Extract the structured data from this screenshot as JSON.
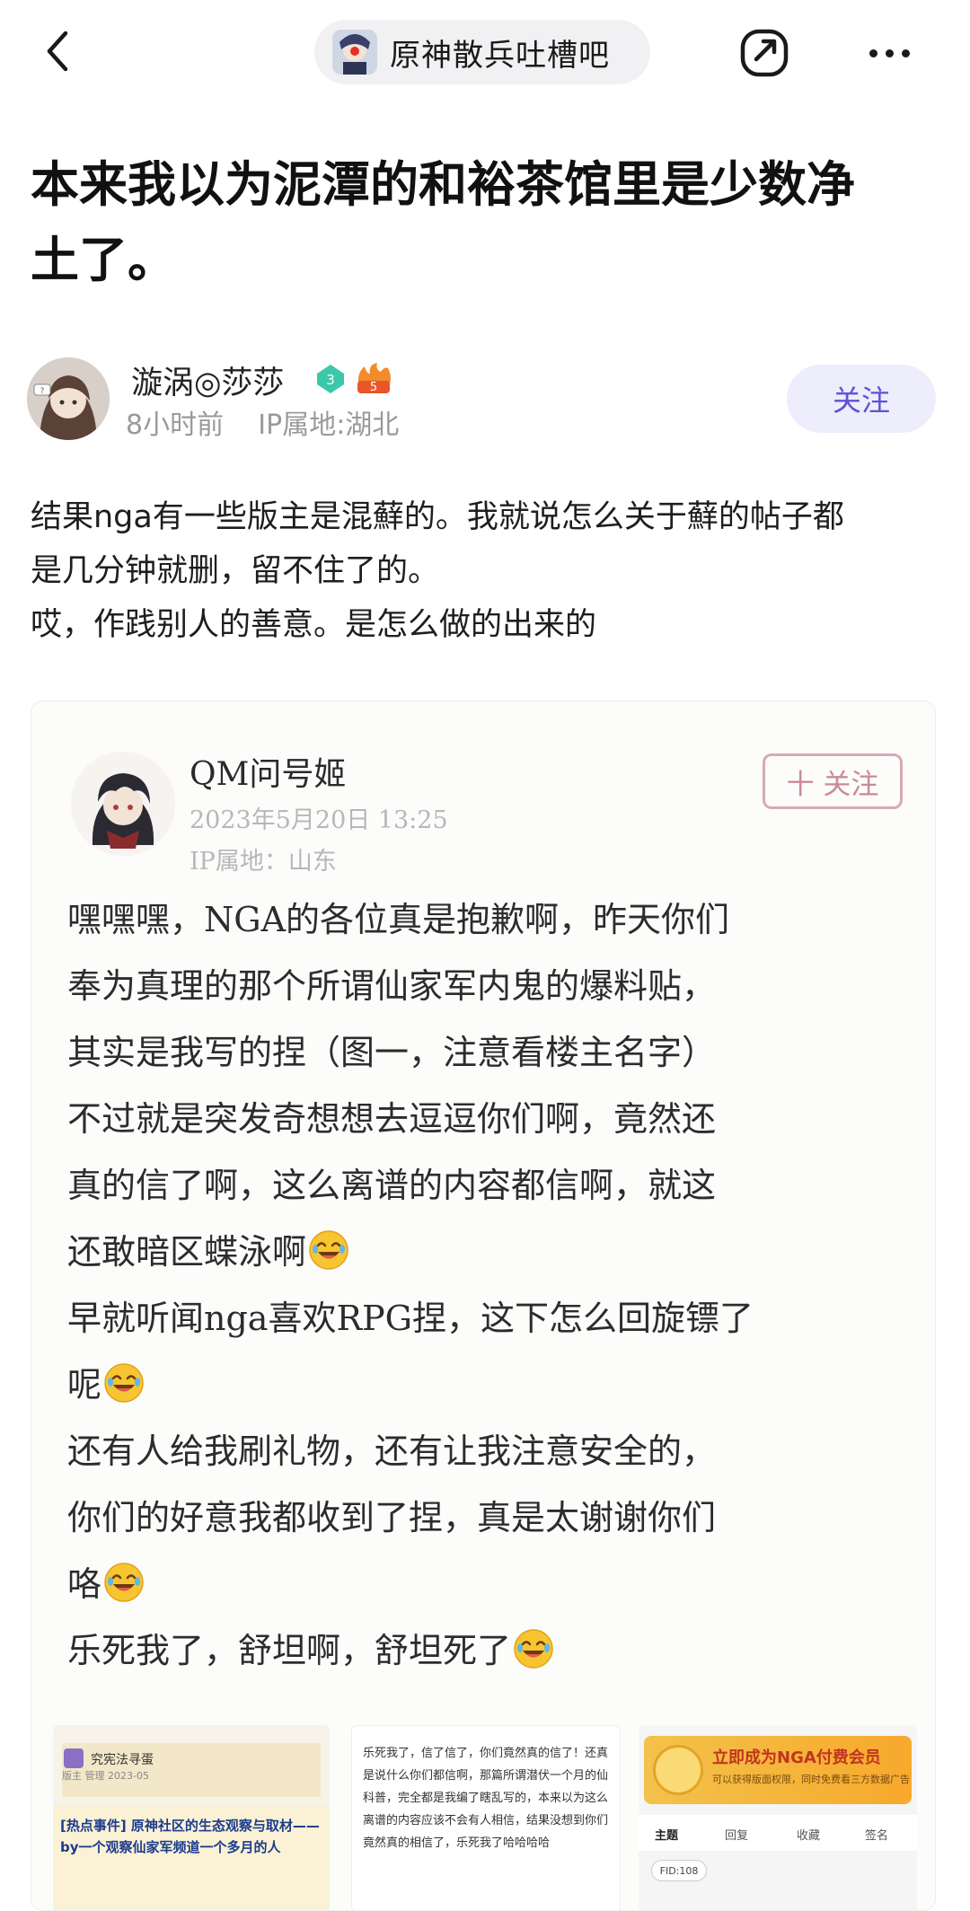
{
  "header": {
    "forum_name": "原神散兵吐槽吧"
  },
  "post": {
    "title_lines": [
      "本来我以为泥潭的和裕茶馆里是少数净",
      "土了。"
    ],
    "author": {
      "name": "漩涡◎莎莎",
      "level": "3",
      "fire_badge": "5",
      "time": "8小时前",
      "ip": "IP属地:湖北"
    },
    "follow_label": "关注",
    "body_lines": [
      "结果nga有一些版主是混蘚的。我就说怎么关于蘚的帖子都",
      "是几分钟就删，留不住了的。",
      "哎，作践别人的善意。是怎么做的出来的"
    ]
  },
  "embedded": {
    "name": "QM问号姬",
    "date": "2023年5月20日 13:25",
    "ip": "IP属地：山东",
    "follow_label": "十 关注",
    "lines": [
      "嘿嘿嘿，NGA的各位真是抱歉啊，昨天你们",
      "奉为真理的那个所谓仙家军内鬼的爆料贴，",
      "其实是我写的捏（图一，注意看楼主名字）",
      "不过就是突发奇想想去逗逗你们啊，竟然还",
      "真的信了啊，这么离谱的内容都信啊，就这",
      "还敢暗区蝶泳啊",
      "早就听闻nga喜欢RPG捏，这下怎么回旋镖了",
      "呢",
      "还有人给我刷礼物，还有让我注意安全的，",
      "你们的好意我都收到了捏，真是太谢谢你们",
      "咯",
      "乐死我了，舒坦啊，舒坦死了"
    ],
    "emoji_after_lines": [
      5,
      7,
      10,
      11
    ],
    "thumbs": {
      "t1_name": "究宪法寻蛋",
      "t1_sub": "版主  管理  2023-05",
      "t1_title": "[热点事件] 原神社区的生态观察与取材——by一个观察仙家军频道一个多月的人",
      "t2_text": "乐死我了，信了信了，你们竟然真的信了！还真是说什么你们都信啊，那篇所谓潜伏一个月的仙科普，完全都是我编了瞎乱写的，本来以为这么离谱的内容应该不会有人相信，结果没想到你们竟然真的相信了，乐死我了哈哈哈哈",
      "t3_title": "立即成为NGA付费会员",
      "t3_sub": "可以获得版面权限，同时免费看三方数据广告",
      "t3_tabs": [
        "主题",
        "回复",
        "收藏",
        "签名"
      ],
      "t3_tag": "FID:108"
    }
  }
}
